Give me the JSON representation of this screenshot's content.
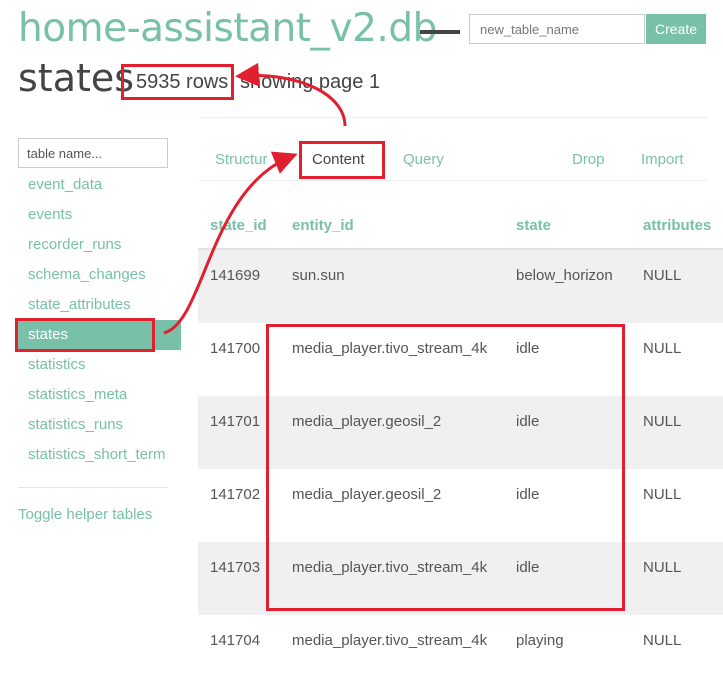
{
  "header": {
    "db_title": "home-assistant_v2.db",
    "new_table_placeholder": "new_table_name",
    "create_label": "Create",
    "table_title": "states",
    "rows_count": "5935 rows",
    "showing_page": "showing page 1"
  },
  "sidebar": {
    "search_placeholder": "table name...",
    "items": [
      {
        "label": "event_data"
      },
      {
        "label": "events"
      },
      {
        "label": "recorder_runs"
      },
      {
        "label": "schema_changes"
      },
      {
        "label": "state_attributes"
      },
      {
        "label": "states",
        "active": true
      },
      {
        "label": "statistics"
      },
      {
        "label": "statistics_meta"
      },
      {
        "label": "statistics_runs"
      },
      {
        "label": "statistics_short_term"
      }
    ],
    "toggle_helper": "Toggle helper tables"
  },
  "tabs": {
    "structure": "Structure",
    "content": "Content",
    "query": "Query",
    "drop": "Drop",
    "import": "Import",
    "active": "content"
  },
  "table": {
    "columns": [
      "state_id",
      "entity_id",
      "state",
      "attributes"
    ],
    "rows": [
      [
        "141699",
        "sun.sun",
        "below_horizon",
        "NULL"
      ],
      [
        "141700",
        "media_player.tivo_stream_4k",
        "idle",
        "NULL"
      ],
      [
        "141701",
        "media_player.geosil_2",
        "idle",
        "NULL"
      ],
      [
        "141702",
        "media_player.geosil_2",
        "idle",
        "NULL"
      ],
      [
        "141703",
        "media_player.tivo_stream_4k",
        "idle",
        "NULL"
      ],
      [
        "141704",
        "media_player.tivo_stream_4k",
        "playing",
        "NULL"
      ]
    ]
  },
  "colors": {
    "accent": "#79c0a8",
    "annotation": "#e0202e",
    "row_stripe": "#f0f0f0"
  }
}
